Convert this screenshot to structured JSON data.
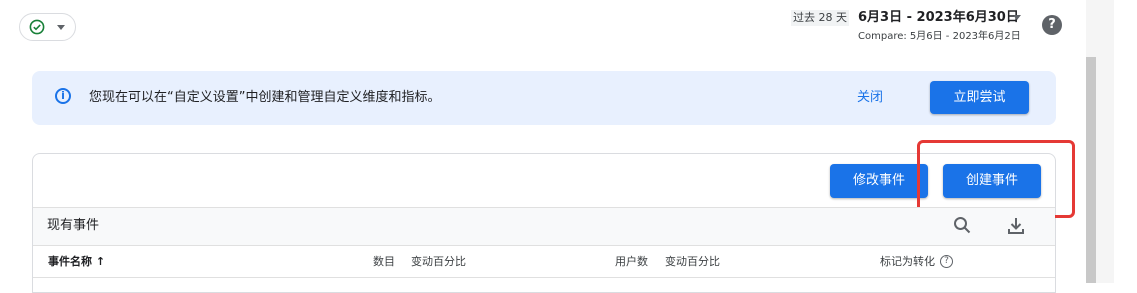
{
  "header": {
    "range_label": "过去 28 天",
    "date_range": "6月3日 - 2023年6月30日",
    "compare": "Compare: 5月6日 - 2023年6月2日",
    "help_glyph": "?",
    "status_icon": "check-circle-icon"
  },
  "banner": {
    "info_glyph": "i",
    "text": "您现在可以在“自定义设置”中创建和管理自定义维度和指标。",
    "dismiss": "关闭",
    "try_now": "立即尝试"
  },
  "events": {
    "modify_button": "修改事件",
    "create_button": "创建事件",
    "section_title": "现有事件",
    "columns": {
      "name": "事件名称",
      "sort_arrow": "↑",
      "count": "数目",
      "count_change": "变动百分比",
      "users": "用户数",
      "users_change": "变动百分比",
      "mark_conversion": "标记为转化"
    },
    "help_glyph": "?"
  },
  "colors": {
    "accent": "#1a73e8",
    "banner_bg": "#e8f0fe",
    "highlight": "#e53935",
    "success": "#188038"
  }
}
